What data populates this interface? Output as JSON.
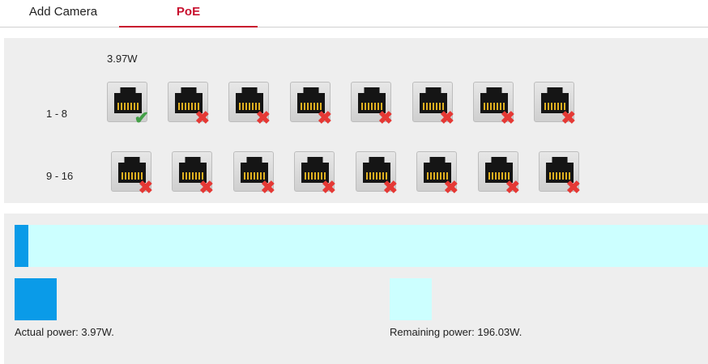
{
  "tabs": {
    "add_camera": "Add Camera",
    "poe": "PoE"
  },
  "ports": {
    "row_labels": [
      "1 - 8",
      "9 - 16"
    ],
    "port1_power": "3.97W",
    "port_status": [
      "connected",
      "disconnected",
      "disconnected",
      "disconnected",
      "disconnected",
      "disconnected",
      "disconnected",
      "disconnected",
      "disconnected",
      "disconnected",
      "disconnected",
      "disconnected",
      "disconnected",
      "disconnected",
      "disconnected",
      "disconnected"
    ],
    "status_icons": {
      "connected": "check-icon",
      "disconnected": "x-icon"
    }
  },
  "power": {
    "used_fraction": 0.0199,
    "actual_label": "Actual power: 3.97W.",
    "remaining_label": "Remaining power: 196.03W.",
    "colors": {
      "actual": "#0a9be8",
      "remaining": "#ccffff"
    }
  },
  "colors": {
    "accent": "#c8102e",
    "ok": "#43a047",
    "bad": "#e53935"
  }
}
